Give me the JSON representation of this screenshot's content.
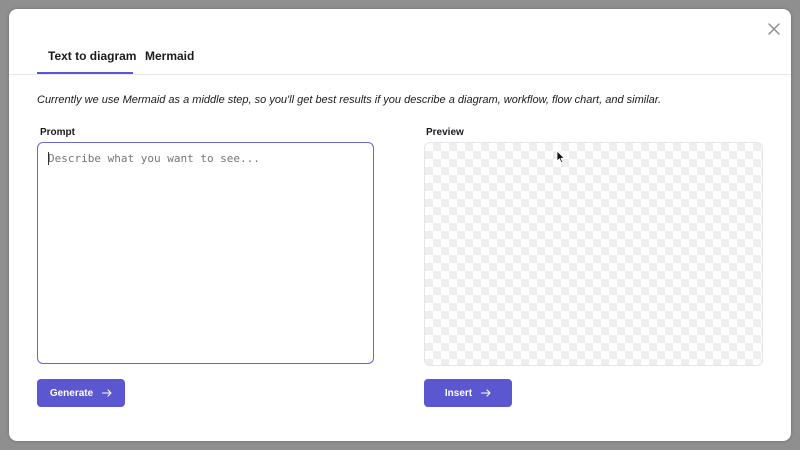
{
  "tabs": [
    {
      "label": "Text to diagram",
      "active": true
    },
    {
      "label": "Mermaid",
      "active": false
    }
  ],
  "note": "Currently we use Mermaid as a middle step, so you'll get best results if you describe a diagram, workflow, flow chart, and similar.",
  "prompt": {
    "label": "Prompt",
    "placeholder": "Describe what you want to see...",
    "value": ""
  },
  "preview": {
    "label": "Preview"
  },
  "buttons": {
    "generate": "Generate",
    "insert": "Insert"
  },
  "icons": {
    "close": "close-icon",
    "arrow": "arrow-right-icon",
    "cursor": "mouse-pointer-icon"
  },
  "colors": {
    "accent": "#5b57d1",
    "text": "#1b1b1f",
    "placeholder": "#8d8d94"
  }
}
